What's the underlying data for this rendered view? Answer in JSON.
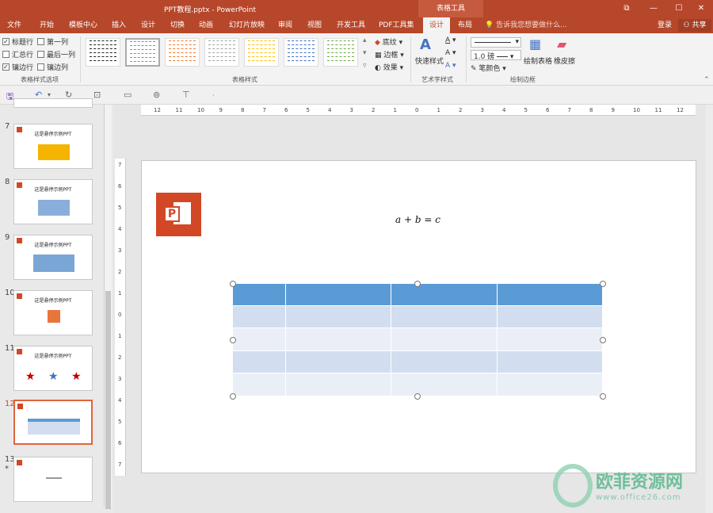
{
  "window": {
    "title": "PPT教程.pptx - PowerPoint",
    "context_tab_group": "表格工具"
  },
  "window_controls": {
    "restore": "⧉",
    "minimize": "—",
    "maximize": "☐",
    "close": "✕"
  },
  "tabs": [
    "文件",
    "开始",
    "模板中心",
    "插入",
    "设计",
    "切换",
    "动画",
    "幻灯片放映",
    "审阅",
    "视图",
    "开发工具",
    "PDF工具集",
    "设计",
    "布局"
  ],
  "active_tab_index": 12,
  "tell_me": "告诉我您想要做什么...",
  "login": "登录",
  "share": "共享",
  "ribbon": {
    "options": [
      {
        "label": "标题行",
        "checked": true
      },
      {
        "label": "第一列",
        "checked": false
      },
      {
        "label": "汇总行",
        "checked": false
      },
      {
        "label": "最后一列",
        "checked": false
      },
      {
        "label": "镶边行",
        "checked": true
      },
      {
        "label": "镶边列",
        "checked": false
      }
    ],
    "options_group": "表格样式选项",
    "styles_group": "表格样式",
    "shading": "底纹",
    "border": "边框",
    "effects": "效果",
    "quick_styles": "快速样式",
    "art_group": "艺术字样式",
    "pen_weight": "1.0 磅",
    "pen_color": "笔颜色",
    "draw_table": "绘制表格",
    "eraser": "橡皮擦",
    "draw_group": "绘制边框",
    "style_colors": [
      "#222222",
      "#5b9bd5",
      "#ed7d31",
      "#a5a5a5",
      "#ffc000",
      "#4472c4",
      "#70ad47"
    ]
  },
  "slides": [
    {
      "num": "7",
      "title": "这是悬停示例PPT"
    },
    {
      "num": "8",
      "title": "这是悬停示例PPT"
    },
    {
      "num": "9",
      "title": "这是悬停示例PPT"
    },
    {
      "num": "10",
      "title": "这是悬停示例PPT"
    },
    {
      "num": "11",
      "title": "这是悬停示例PPT"
    },
    {
      "num": "12",
      "title": ""
    },
    {
      "num": "13",
      "title": ""
    }
  ],
  "slide13_star": "*",
  "formula": "a + b = c",
  "hruler_labels": [
    "12",
    "11",
    "10",
    "9",
    "8",
    "7",
    "6",
    "5",
    "4",
    "3",
    "2",
    "1",
    "0",
    "1",
    "2",
    "3",
    "4",
    "5",
    "6",
    "7",
    "8",
    "9",
    "10",
    "11",
    "12"
  ],
  "vruler_labels": [
    "7",
    "6",
    "5",
    "4",
    "3",
    "2",
    "1",
    "0",
    "1",
    "2",
    "3",
    "4",
    "5",
    "6",
    "7"
  ],
  "watermark": {
    "brand": "欧菲资源网",
    "url": "www.office26.com"
  },
  "colors": {
    "accent": "#b7472a",
    "table_header": "#5b9bd5",
    "table_band": "#d2deef"
  }
}
